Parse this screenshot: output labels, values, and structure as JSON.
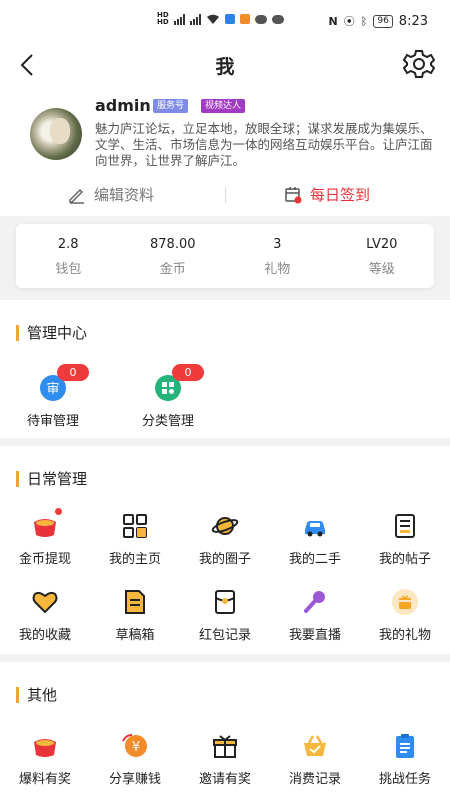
{
  "status_bar": {
    "time": "8:23",
    "battery": "96",
    "net_type": "4G"
  },
  "nav": {
    "title": "我"
  },
  "profile": {
    "username": "admin",
    "badges": [
      "服务号",
      "视频达人"
    ],
    "bio": "魅力庐江论坛，立足本地，放眼全球；谋求发展成为集娱乐、文学、生活、市场信息为一体的网络互动娱乐平台。让庐江面向世界，让世界了解庐江。",
    "edit_label": "编辑资料",
    "checkin_label": "每日签到"
  },
  "stats": [
    {
      "value": "2.8",
      "label": "钱包"
    },
    {
      "value": "878.00",
      "label": "金币"
    },
    {
      "value": "3",
      "label": "礼物"
    },
    {
      "value": "LV20",
      "label": "等级"
    }
  ],
  "management": {
    "title": "管理中心",
    "items": [
      {
        "label": "待审管理",
        "badge": "0",
        "icon": "pending-review-icon"
      },
      {
        "label": "分类管理",
        "badge": "0",
        "icon": "category-manage-icon"
      }
    ]
  },
  "daily": {
    "title": "日常管理",
    "items": [
      {
        "label": "金币提现",
        "icon": "coin-withdraw-icon"
      },
      {
        "label": "我的主页",
        "icon": "homepage-grid-icon"
      },
      {
        "label": "我的圈子",
        "icon": "planet-icon"
      },
      {
        "label": "我的二手",
        "icon": "car-icon"
      },
      {
        "label": "我的帖子",
        "icon": "post-icon"
      },
      {
        "label": "我的收藏",
        "icon": "heart-icon"
      },
      {
        "label": "草稿箱",
        "icon": "draft-icon"
      },
      {
        "label": "红包记录",
        "icon": "red-envelope-icon"
      },
      {
        "label": "我要直播",
        "icon": "microphone-icon"
      },
      {
        "label": "我的礼物",
        "icon": "gift-box-icon"
      }
    ]
  },
  "other": {
    "title": "其他",
    "items": [
      {
        "label": "爆料有奖",
        "icon": "reward-pot-icon"
      },
      {
        "label": "分享赚钱",
        "icon": "share-money-icon"
      },
      {
        "label": "邀请有奖",
        "icon": "invite-gift-icon"
      },
      {
        "label": "消费记录",
        "icon": "shopping-basket-icon"
      },
      {
        "label": "挑战任务",
        "icon": "clipboard-icon"
      }
    ]
  }
}
